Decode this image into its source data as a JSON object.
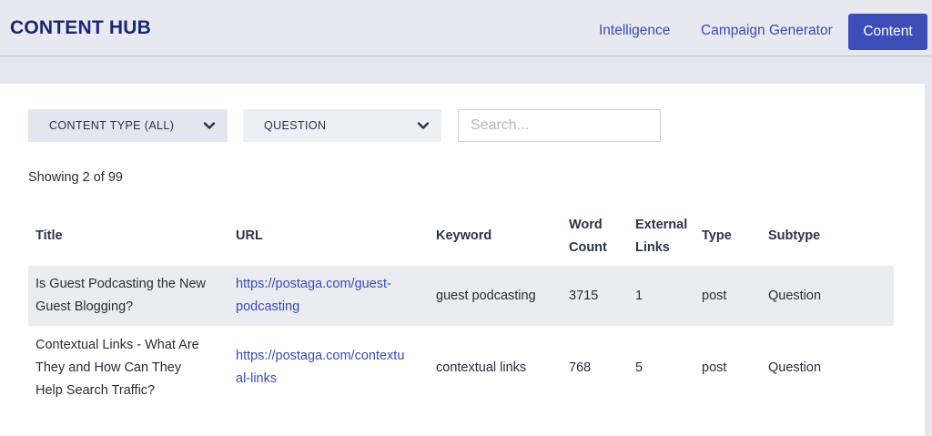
{
  "header": {
    "brand": "CONTENT HUB",
    "nav": [
      "Intelligence",
      "Campaign Generator"
    ],
    "active": "Content"
  },
  "filters": {
    "content_type": "CONTENT TYPE (ALL)",
    "subtype": "QUESTION",
    "search_placeholder": "Search..."
  },
  "summary": "Showing 2 of 99",
  "table": {
    "columns": {
      "title": "Title",
      "url": "URL",
      "keyword": "Keyword",
      "word_count_1": "Word",
      "word_count_2": "Count",
      "external_links_1": "External",
      "external_links_2": "Links",
      "type": "Type",
      "subtype": "Subtype"
    },
    "rows": [
      {
        "title_1": "Is Guest Podcasting the New",
        "title_2": "Guest Blogging?",
        "url_1": "https://postaga.com/guest-",
        "url_2": "podcasting",
        "keyword": "guest podcasting",
        "word_count": "3715",
        "external_links": "1",
        "type": "post",
        "subtype": "Question"
      },
      {
        "title_1": "Contextual Links - What Are",
        "title_2": "They and How Can They",
        "title_3": "Help Search Traffic?",
        "url_1": "https://postaga.com/contextu",
        "url_2": "al-links",
        "keyword": "contextual links",
        "word_count": "768",
        "external_links": "5",
        "type": "post",
        "subtype": "Question"
      }
    ]
  },
  "icons": {
    "dropdown": "chevron-down-icon"
  }
}
